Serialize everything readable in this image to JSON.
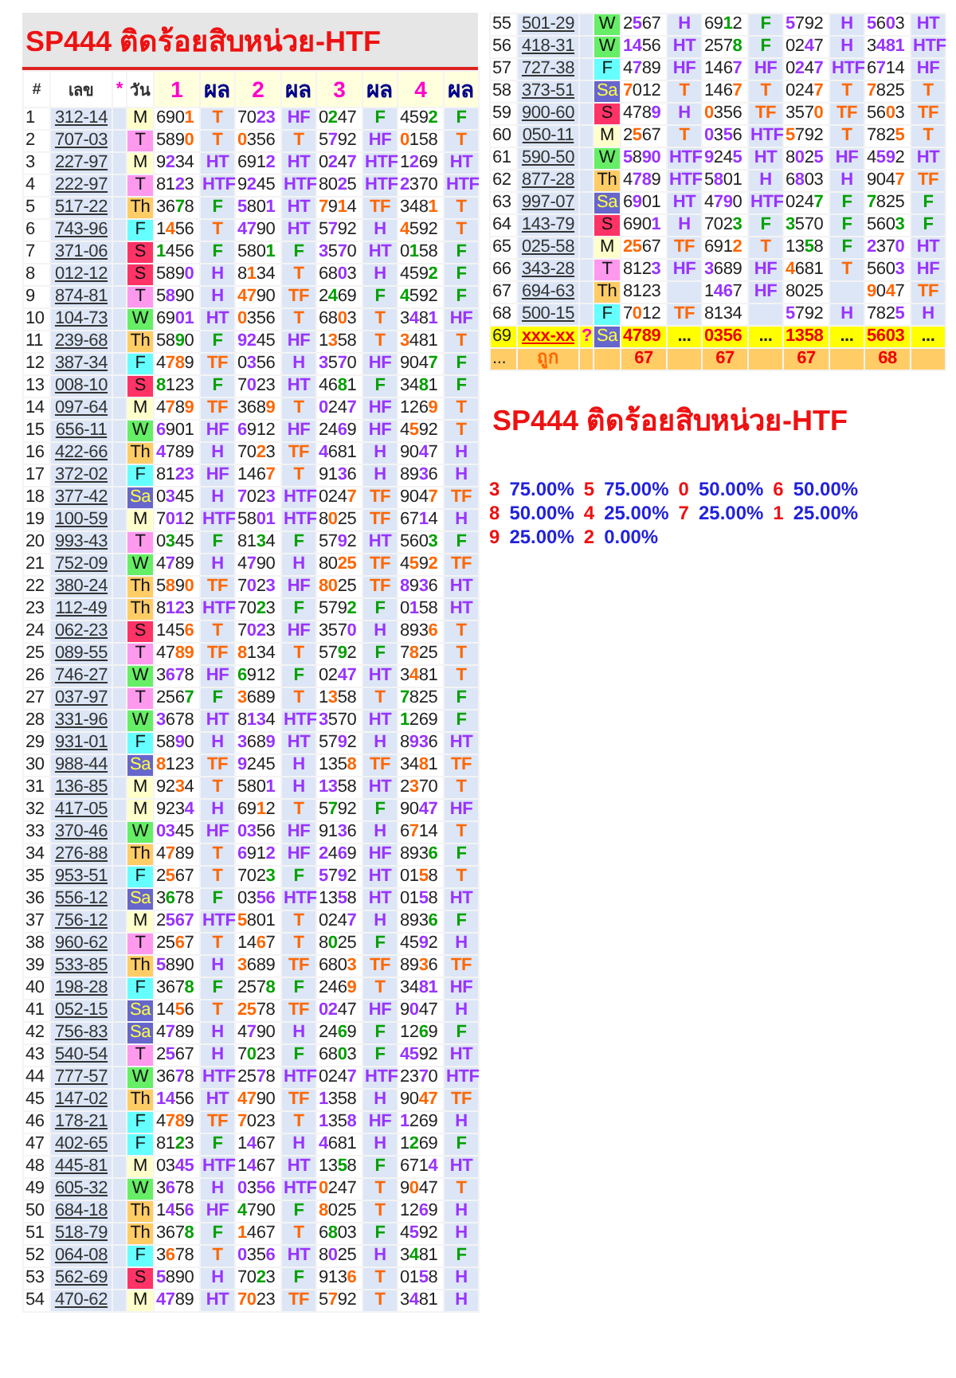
{
  "left_table": {
    "title": "SP444 ติดร้อยสิบหน่วย-HTF",
    "columns": [
      "#",
      "เลข",
      "*",
      "วัน",
      "1",
      "ผล",
      "2",
      "ผล",
      "3",
      "ผล",
      "4",
      "ผล"
    ],
    "rows": [
      {
        "no": "1",
        "number": "312-14",
        "day": "M",
        "color": "#ffffcc",
        "picks": [
          "6901",
          "7023",
          "0247",
          "4592"
        ],
        "results": [
          "T",
          "HF",
          "F",
          "F"
        ]
      },
      {
        "no": "2",
        "number": "707-03",
        "day": "T",
        "color": "#ff99ee",
        "picks": [
          "5890",
          "0356",
          "5792",
          "0158"
        ],
        "results": [
          "T",
          "T",
          "HF",
          "T"
        ]
      },
      {
        "no": "3",
        "number": "227-97",
        "day": "M",
        "color": "#ffffcc",
        "picks": [
          "9234",
          "6912",
          "0247",
          "1269"
        ],
        "results": [
          "HT",
          "HT",
          "HTF",
          "HT"
        ]
      },
      {
        "no": "4",
        "number": "222-97",
        "day": "T",
        "color": "#ff99ee",
        "picks": [
          "8123",
          "9245",
          "8025",
          "2370"
        ],
        "results": [
          "HTF",
          "HTF",
          "HTF",
          "HTF"
        ]
      },
      {
        "no": "5",
        "number": "517-22",
        "day": "Th",
        "color": "#ffcc66",
        "picks": [
          "3678",
          "5801",
          "7914",
          "3481"
        ],
        "results": [
          "F",
          "HT",
          "TF",
          "T"
        ]
      },
      {
        "no": "6",
        "number": "743-96",
        "day": "F",
        "color": "#66ffff",
        "picks": [
          "1456",
          "4790",
          "5792",
          "4592"
        ],
        "results": [
          "T",
          "HT",
          "H",
          "T"
        ]
      },
      {
        "no": "7",
        "number": "371-06",
        "day": "S",
        "color": "#ff3366",
        "picks": [
          "1456",
          "5801",
          "3570",
          "0158"
        ],
        "results": [
          "F",
          "F",
          "HT",
          "F"
        ]
      },
      {
        "no": "8",
        "number": "012-12",
        "day": "S",
        "color": "#ff3366",
        "picks": [
          "5890",
          "8134",
          "6803",
          "4592"
        ],
        "results": [
          "H",
          "T",
          "H",
          "F"
        ]
      },
      {
        "no": "9",
        "number": "874-81",
        "day": "T",
        "color": "#ff99ee",
        "picks": [
          "5890",
          "4790",
          "2469",
          "4592"
        ],
        "results": [
          "H",
          "TF",
          "F",
          "F"
        ]
      },
      {
        "no": "10",
        "number": "104-73",
        "day": "W",
        "color": "#66ee66",
        "picks": [
          "6901",
          "0356",
          "6803",
          "3481"
        ],
        "results": [
          "HT",
          "T",
          "T",
          "HF"
        ]
      },
      {
        "no": "11",
        "number": "239-68",
        "day": "Th",
        "color": "#ffcc66",
        "picks": [
          "5890",
          "9245",
          "1358",
          "3481"
        ],
        "results": [
          "F",
          "HF",
          "T",
          "T"
        ]
      },
      {
        "no": "12",
        "number": "387-34",
        "day": "F",
        "color": "#66ffff",
        "picks": [
          "4789",
          "0356",
          "3570",
          "9047"
        ],
        "results": [
          "TF",
          "H",
          "HF",
          "F"
        ]
      },
      {
        "no": "13",
        "number": "008-10",
        "day": "S",
        "color": "#ff3366",
        "picks": [
          "8123",
          "7023",
          "4681",
          "3481"
        ],
        "results": [
          "F",
          "HT",
          "F",
          "F"
        ]
      },
      {
        "no": "14",
        "number": "097-64",
        "day": "M",
        "color": "#ffffcc",
        "picks": [
          "4789",
          "3689",
          "0247",
          "1269"
        ],
        "results": [
          "TF",
          "T",
          "HF",
          "T"
        ]
      },
      {
        "no": "15",
        "number": "656-11",
        "day": "W",
        "color": "#66ee66",
        "picks": [
          "6901",
          "6912",
          "2469",
          "4592"
        ],
        "results": [
          "HF",
          "HF",
          "HF",
          "T"
        ]
      },
      {
        "no": "16",
        "number": "422-66",
        "day": "Th",
        "color": "#ffcc66",
        "picks": [
          "4789",
          "7023",
          "4681",
          "9047"
        ],
        "results": [
          "H",
          "TF",
          "H",
          "H"
        ]
      },
      {
        "no": "17",
        "number": "372-02",
        "day": "F",
        "color": "#66ffff",
        "picks": [
          "8123",
          "1467",
          "9136",
          "8936"
        ],
        "results": [
          "HF",
          "T",
          "H",
          "H"
        ]
      },
      {
        "no": "18",
        "number": "377-42",
        "day": "Sa",
        "color": "#6666cc",
        "picks": [
          "0345",
          "7023",
          "0247",
          "9047"
        ],
        "results": [
          "H",
          "HTF",
          "TF",
          "TF"
        ]
      },
      {
        "no": "19",
        "number": "100-59",
        "day": "M",
        "color": "#ffffcc",
        "picks": [
          "7012",
          "5801",
          "8025",
          "6714"
        ],
        "results": [
          "HTF",
          "HTF",
          "TF",
          "H"
        ]
      },
      {
        "no": "20",
        "number": "993-43",
        "day": "T",
        "color": "#ff99ee",
        "picks": [
          "0345",
          "8134",
          "5792",
          "5603"
        ],
        "results": [
          "F",
          "F",
          "HT",
          "F"
        ]
      },
      {
        "no": "21",
        "number": "752-09",
        "day": "W",
        "color": "#66ee66",
        "picks": [
          "4789",
          "4790",
          "8025",
          "4592"
        ],
        "results": [
          "H",
          "H",
          "TF",
          "TF"
        ]
      },
      {
        "no": "22",
        "number": "380-24",
        "day": "Th",
        "color": "#ffcc66",
        "picks": [
          "5890",
          "7023",
          "8025",
          "8936"
        ],
        "results": [
          "TF",
          "HF",
          "TF",
          "HT"
        ]
      },
      {
        "no": "23",
        "number": "112-49",
        "day": "Th",
        "color": "#ffcc66",
        "picks": [
          "8123",
          "7023",
          "5792",
          "0158"
        ],
        "results": [
          "HTF",
          "F",
          "F",
          "HT"
        ]
      },
      {
        "no": "24",
        "number": "062-23",
        "day": "S",
        "color": "#ff3366",
        "picks": [
          "1456",
          "7023",
          "3570",
          "8936"
        ],
        "results": [
          "T",
          "HF",
          "H",
          "T"
        ]
      },
      {
        "no": "25",
        "number": "089-55",
        "day": "T",
        "color": "#ff99ee",
        "picks": [
          "4789",
          "8134",
          "5792",
          "7825"
        ],
        "results": [
          "TF",
          "T",
          "F",
          "T"
        ]
      },
      {
        "no": "26",
        "number": "746-27",
        "day": "W",
        "color": "#66ee66",
        "picks": [
          "3678",
          "6912",
          "0247",
          "3481"
        ],
        "results": [
          "HF",
          "F",
          "HT",
          "T"
        ]
      },
      {
        "no": "27",
        "number": "037-97",
        "day": "T",
        "color": "#ff99ee",
        "picks": [
          "2567",
          "3689",
          "1358",
          "7825"
        ],
        "results": [
          "F",
          "T",
          "T",
          "F"
        ]
      },
      {
        "no": "28",
        "number": "331-96",
        "day": "W",
        "color": "#66ee66",
        "picks": [
          "3678",
          "8134",
          "3570",
          "1269"
        ],
        "results": [
          "HT",
          "HTF",
          "HT",
          "F"
        ]
      },
      {
        "no": "29",
        "number": "931-01",
        "day": "F",
        "color": "#66ffff",
        "picks": [
          "5890",
          "3689",
          "5792",
          "8936"
        ],
        "results": [
          "H",
          "HT",
          "H",
          "HT"
        ]
      },
      {
        "no": "30",
        "number": "988-44",
        "day": "Sa",
        "color": "#6666cc",
        "picks": [
          "8123",
          "9245",
          "1358",
          "3481"
        ],
        "results": [
          "TF",
          "H",
          "TF",
          "TF"
        ]
      },
      {
        "no": "31",
        "number": "136-85",
        "day": "M",
        "color": "#ffffcc",
        "picks": [
          "9234",
          "5801",
          "1358",
          "2370"
        ],
        "results": [
          "T",
          "H",
          "HT",
          "T"
        ]
      },
      {
        "no": "32",
        "number": "417-05",
        "day": "M",
        "color": "#ffffcc",
        "picks": [
          "9234",
          "6912",
          "5792",
          "9047"
        ],
        "results": [
          "H",
          "T",
          "F",
          "HF"
        ]
      },
      {
        "no": "33",
        "number": "370-46",
        "day": "W",
        "color": "#66ee66",
        "picks": [
          "0345",
          "0356",
          "9136",
          "6714"
        ],
        "results": [
          "HF",
          "HF",
          "H",
          "T"
        ]
      },
      {
        "no": "34",
        "number": "276-88",
        "day": "Th",
        "color": "#ffcc66",
        "picks": [
          "4789",
          "6912",
          "2469",
          "8936"
        ],
        "results": [
          "T",
          "HF",
          "HF",
          "F"
        ]
      },
      {
        "no": "35",
        "number": "953-51",
        "day": "F",
        "color": "#66ffff",
        "picks": [
          "2567",
          "7023",
          "5792",
          "0158"
        ],
        "results": [
          "T",
          "F",
          "HT",
          "T"
        ]
      },
      {
        "no": "36",
        "number": "556-12",
        "day": "Sa",
        "color": "#6666cc",
        "picks": [
          "3678",
          "0356",
          "1358",
          "0158"
        ],
        "results": [
          "F",
          "HTF",
          "HT",
          "HT"
        ]
      },
      {
        "no": "37",
        "number": "756-12",
        "day": "M",
        "color": "#ffffcc",
        "picks": [
          "2567",
          "5801",
          "0247",
          "8936"
        ],
        "results": [
          "HTF",
          "T",
          "H",
          "F"
        ]
      },
      {
        "no": "38",
        "number": "960-62",
        "day": "T",
        "color": "#ff99ee",
        "picks": [
          "2567",
          "1467",
          "8025",
          "4592"
        ],
        "results": [
          "T",
          "T",
          "F",
          "H"
        ]
      },
      {
        "no": "39",
        "number": "533-85",
        "day": "Th",
        "color": "#ffcc66",
        "picks": [
          "5890",
          "3689",
          "6803",
          "8936"
        ],
        "results": [
          "H",
          "TF",
          "TF",
          "TF"
        ]
      },
      {
        "no": "40",
        "number": "198-28",
        "day": "F",
        "color": "#66ffff",
        "picks": [
          "3678",
          "2578",
          "2469",
          "3481"
        ],
        "results": [
          "F",
          "F",
          "T",
          "HF"
        ]
      },
      {
        "no": "41",
        "number": "052-15",
        "day": "Sa",
        "color": "#6666cc",
        "picks": [
          "1456",
          "2578",
          "0247",
          "9047"
        ],
        "results": [
          "T",
          "TF",
          "HF",
          "H"
        ]
      },
      {
        "no": "42",
        "number": "756-83",
        "day": "Sa",
        "color": "#6666cc",
        "picks": [
          "4789",
          "4790",
          "2469",
          "1269"
        ],
        "results": [
          "H",
          "H",
          "F",
          "F"
        ]
      },
      {
        "no": "43",
        "number": "540-54",
        "day": "T",
        "color": "#ff99ee",
        "picks": [
          "2567",
          "7023",
          "6803",
          "4592"
        ],
        "results": [
          "H",
          "F",
          "F",
          "HT"
        ]
      },
      {
        "no": "44",
        "number": "777-57",
        "day": "W",
        "color": "#66ee66",
        "picks": [
          "3678",
          "2578",
          "0247",
          "2370"
        ],
        "results": [
          "HTF",
          "HTF",
          "HTF",
          "HTF"
        ]
      },
      {
        "no": "45",
        "number": "147-02",
        "day": "Th",
        "color": "#ffcc66",
        "picks": [
          "1456",
          "4790",
          "1358",
          "9047"
        ],
        "results": [
          "HT",
          "TF",
          "H",
          "TF"
        ]
      },
      {
        "no": "46",
        "number": "178-21",
        "day": "F",
        "color": "#66ffff",
        "picks": [
          "4789",
          "7023",
          "1358",
          "1269"
        ],
        "results": [
          "TF",
          "T",
          "HF",
          "H"
        ]
      },
      {
        "no": "47",
        "number": "402-65",
        "day": "F",
        "color": "#66ffff",
        "picks": [
          "8123",
          "1467",
          "4681",
          "1269"
        ],
        "results": [
          "F",
          "H",
          "H",
          "F"
        ]
      },
      {
        "no": "48",
        "number": "445-81",
        "day": "M",
        "color": "#ffffcc",
        "picks": [
          "0345",
          "1467",
          "1358",
          "6714"
        ],
        "results": [
          "HTF",
          "HT",
          "F",
          "HT"
        ]
      },
      {
        "no": "49",
        "number": "605-32",
        "day": "W",
        "color": "#66ee66",
        "picks": [
          "3678",
          "0356",
          "0247",
          "9047"
        ],
        "results": [
          "H",
          "HTF",
          "T",
          "T"
        ]
      },
      {
        "no": "50",
        "number": "684-18",
        "day": "Th",
        "color": "#ffcc66",
        "picks": [
          "1456",
          "4790",
          "8025",
          "1269"
        ],
        "results": [
          "HF",
          "F",
          "T",
          "H"
        ]
      },
      {
        "no": "51",
        "number": "518-79",
        "day": "Th",
        "color": "#ffcc66",
        "picks": [
          "3678",
          "1467",
          "6803",
          "4592"
        ],
        "results": [
          "F",
          "T",
          "F",
          "H"
        ]
      },
      {
        "no": "52",
        "number": "064-08",
        "day": "F",
        "color": "#66ffff",
        "picks": [
          "3678",
          "0356",
          "8025",
          "3481"
        ],
        "results": [
          "T",
          "HT",
          "H",
          "F"
        ]
      },
      {
        "no": "53",
        "number": "562-69",
        "day": "S",
        "color": "#ff3366",
        "picks": [
          "5890",
          "7023",
          "9136",
          "0158"
        ],
        "results": [
          "H",
          "F",
          "T",
          "H"
        ]
      },
      {
        "no": "54",
        "number": "470-62",
        "day": "M",
        "color": "#ffffcc",
        "picks": [
          "4789",
          "7023",
          "5792",
          "3481"
        ],
        "results": [
          "HT",
          "TF",
          "T",
          "H"
        ]
      }
    ]
  },
  "right_table": {
    "rows": [
      {
        "no": "55",
        "number": "501-29",
        "day": "W",
        "color": "#66ee66",
        "picks": [
          "2567",
          "6912",
          "5792",
          "5603"
        ],
        "results": [
          "H",
          "F",
          "H",
          "HT"
        ]
      },
      {
        "no": "56",
        "number": "418-31",
        "day": "W",
        "color": "#66ee66",
        "picks": [
          "1456",
          "2578",
          "0247",
          "3481"
        ],
        "results": [
          "HT",
          "F",
          "H",
          "HTF"
        ]
      },
      {
        "no": "57",
        "number": "727-38",
        "day": "F",
        "color": "#66ffff",
        "picks": [
          "4789",
          "1467",
          "0247",
          "6714"
        ],
        "results": [
          "HF",
          "HF",
          "HTF",
          "HF"
        ]
      },
      {
        "no": "58",
        "number": "373-51",
        "day": "Sa",
        "color": "#6666cc",
        "picks": [
          "7012",
          "1467",
          "0247",
          "7825"
        ],
        "results": [
          "T",
          "T",
          "T",
          "T"
        ]
      },
      {
        "no": "59",
        "number": "900-60",
        "day": "S",
        "color": "#ff3366",
        "picks": [
          "4789",
          "0356",
          "3570",
          "5603"
        ],
        "results": [
          "H",
          "TF",
          "TF",
          "TF"
        ]
      },
      {
        "no": "60",
        "number": "050-11",
        "day": "M",
        "color": "#ffffcc",
        "picks": [
          "2567",
          "0356",
          "5792",
          "7825"
        ],
        "results": [
          "T",
          "HTF",
          "T",
          "T"
        ]
      },
      {
        "no": "61",
        "number": "590-50",
        "day": "W",
        "color": "#66ee66",
        "picks": [
          "5890",
          "9245",
          "8025",
          "4592"
        ],
        "results": [
          "HTF",
          "HT",
          "HF",
          "HT"
        ]
      },
      {
        "no": "62",
        "number": "877-28",
        "day": "Th",
        "color": "#ffcc66",
        "picks": [
          "4789",
          "5801",
          "6803",
          "9047"
        ],
        "results": [
          "HTF",
          "H",
          "H",
          "TF"
        ]
      },
      {
        "no": "63",
        "number": "997-07",
        "day": "Sa",
        "color": "#6666cc",
        "picks": [
          "6901",
          "4790",
          "0247",
          "7825"
        ],
        "results": [
          "HT",
          "HTF",
          "F",
          "F"
        ]
      },
      {
        "no": "64",
        "number": "143-79",
        "day": "S",
        "color": "#ff3366",
        "picks": [
          "6901",
          "7023",
          "3570",
          "5603"
        ],
        "results": [
          "H",
          "F",
          "F",
          "F"
        ]
      },
      {
        "no": "65",
        "number": "025-58",
        "day": "M",
        "color": "#ffffcc",
        "picks": [
          "2567",
          "6912",
          "1358",
          "2370"
        ],
        "results": [
          "TF",
          "T",
          "F",
          "HT"
        ]
      },
      {
        "no": "66",
        "number": "343-28",
        "day": "T",
        "color": "#ff99ee",
        "picks": [
          "8123",
          "3689",
          "4681",
          "5603"
        ],
        "results": [
          "HF",
          "HF",
          "T",
          "HF"
        ]
      },
      {
        "no": "67",
        "number": "694-63",
        "day": "Th",
        "color": "#ffcc66",
        "cells": [
          {
            "pick": "8123"
          },
          {
            "pick": "1467",
            "result": "HF"
          },
          {
            "pick": "8025"
          },
          {
            "pick": "9047",
            "result": "TF"
          }
        ]
      },
      {
        "no": "68",
        "number": "500-15",
        "day": "F",
        "color": "#66ffff",
        "cells": [
          {
            "pick": "7012",
            "result": "TF"
          },
          {
            "pick": "8134"
          },
          {
            "pick": "5792",
            "result": "H"
          },
          {
            "pick": "7825",
            "result": "H"
          }
        ]
      }
    ],
    "pending_row": {
      "no": "69",
      "number": "xxx-xx",
      "mark": "?",
      "day": "Sa",
      "color": "#6666cc",
      "picks": [
        "4789",
        "0356",
        "1358",
        "5603"
      ],
      "results": [
        "...",
        "...",
        "...",
        "..."
      ]
    },
    "footer": {
      "label": "...",
      "caption": "ถูก",
      "counts": [
        "67",
        "67",
        "67",
        "68"
      ]
    }
  },
  "summary": {
    "title": "SP444 ติดร้อยสิบหน่วย-HTF",
    "stats": [
      {
        "digit": "3",
        "percent": "75.00%"
      },
      {
        "digit": "5",
        "percent": "75.00%"
      },
      {
        "digit": "0",
        "percent": "50.00%"
      },
      {
        "digit": "6",
        "percent": "50.00%"
      },
      {
        "digit": "8",
        "percent": "50.00%"
      },
      {
        "digit": "4",
        "percent": "25.00%"
      },
      {
        "digit": "7",
        "percent": "25.00%"
      },
      {
        "digit": "1",
        "percent": "25.00%"
      },
      {
        "digit": "9",
        "percent": "25.00%"
      },
      {
        "digit": "2",
        "percent": "0.00%"
      }
    ]
  }
}
